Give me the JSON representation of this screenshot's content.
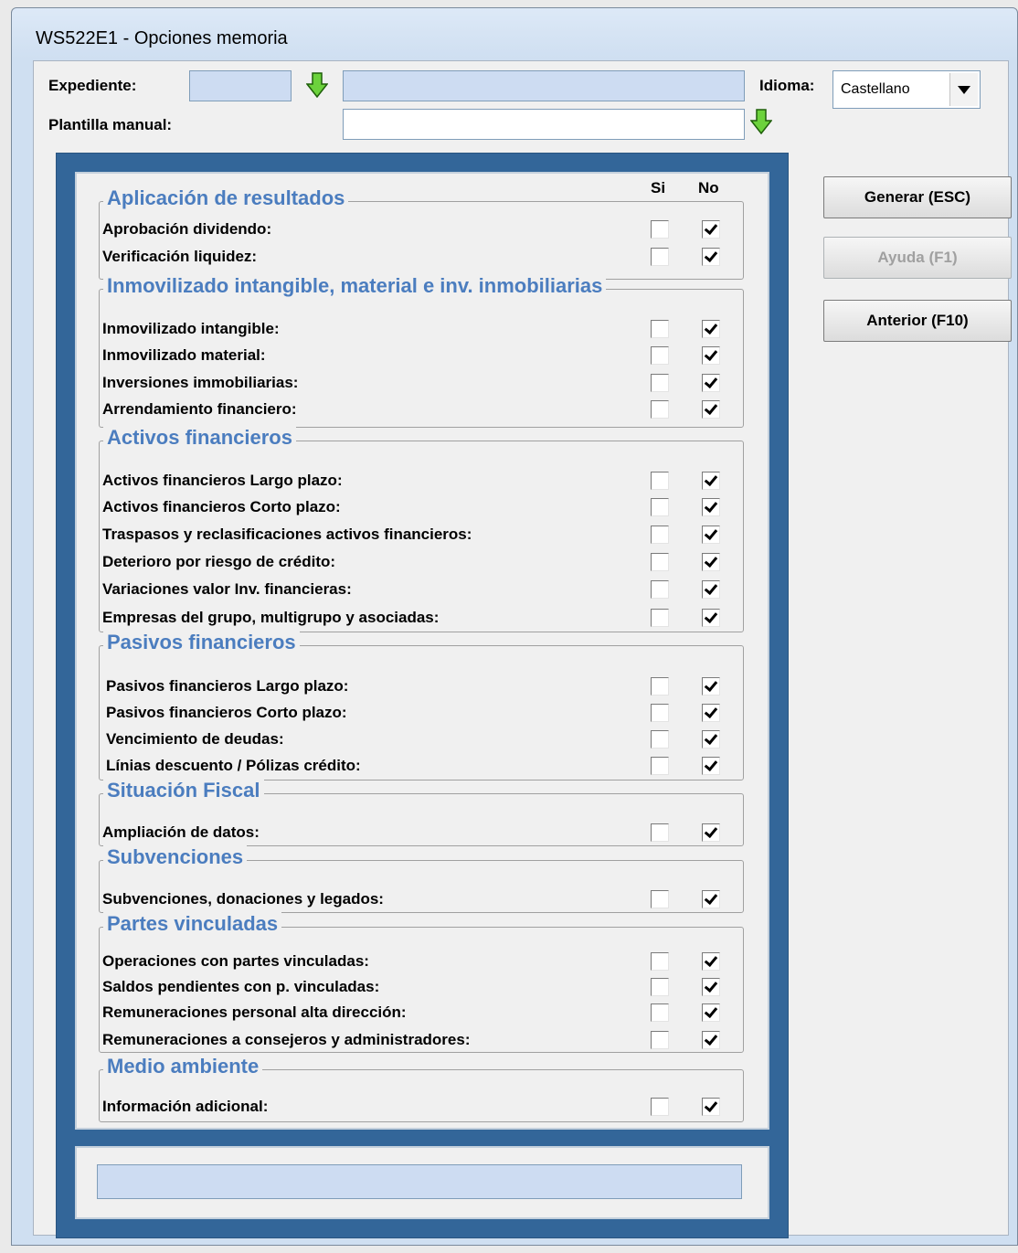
{
  "window": {
    "title": "WS522E1 - Opciones memoria"
  },
  "header": {
    "expediente_label": "Expediente:",
    "expediente_code": "",
    "expediente_name": "",
    "plantilla_label": "Plantilla manual:",
    "plantilla_value": "",
    "idioma_label": "Idioma:",
    "idioma_value": "Castellano"
  },
  "columns": {
    "si": "Si",
    "no": "No"
  },
  "groups": [
    {
      "title": "Aplicación de resultados",
      "items": [
        {
          "label": "Aprobación dividendo:",
          "si": false,
          "no": true
        },
        {
          "label": "Verificación liquidez:",
          "si": false,
          "no": true
        }
      ]
    },
    {
      "title": "Inmovilizado intangible, material e inv. inmobiliarias",
      "items": [
        {
          "label": "Inmovilizado intangible:",
          "si": false,
          "no": true
        },
        {
          "label": "Inmovilizado material:",
          "si": false,
          "no": true
        },
        {
          "label": "Inversiones immobiliarias:",
          "si": false,
          "no": true
        },
        {
          "label": "Arrendamiento financiero:",
          "si": false,
          "no": true
        }
      ]
    },
    {
      "title": "Activos financieros",
      "items": [
        {
          "label": "Activos financieros Largo plazo:",
          "si": false,
          "no": true
        },
        {
          "label": "Activos financieros Corto plazo:",
          "si": false,
          "no": true
        },
        {
          "label": "Traspasos y reclasificaciones activos financieros:",
          "si": false,
          "no": true
        },
        {
          "label": "Deterioro por riesgo de crédito:",
          "si": false,
          "no": true
        },
        {
          "label": "Variaciones valor Inv. financieras:",
          "si": false,
          "no": true
        },
        {
          "label": "Empresas del grupo, multigrupo y asociadas:",
          "si": false,
          "no": true
        }
      ]
    },
    {
      "title": "Pasivos financieros",
      "items": [
        {
          "label": "Pasivos financieros Largo plazo:",
          "si": false,
          "no": true
        },
        {
          "label": "Pasivos financieros Corto plazo:",
          "si": false,
          "no": true
        },
        {
          "label": "Vencimiento de deudas:",
          "si": false,
          "no": true
        },
        {
          "label": "Línias descuento / Pólizas crédito:",
          "si": false,
          "no": true
        }
      ]
    },
    {
      "title": "Situación Fiscal",
      "items": [
        {
          "label": "Ampliación de datos:",
          "si": false,
          "no": true
        }
      ]
    },
    {
      "title": "Subvenciones",
      "items": [
        {
          "label": "Subvenciones, donaciones y legados:",
          "si": false,
          "no": true
        }
      ]
    },
    {
      "title": "Partes vinculadas",
      "items": [
        {
          "label": "Operaciones con partes vinculadas:",
          "si": false,
          "no": true
        },
        {
          "label": "Saldos pendientes con p. vinculadas:",
          "si": false,
          "no": true
        },
        {
          "label": "Remuneraciones personal alta dirección:",
          "si": false,
          "no": true
        },
        {
          "label": "Remuneraciones a consejeros y administradores:",
          "si": false,
          "no": true
        }
      ]
    },
    {
      "title": "Medio ambiente",
      "items": [
        {
          "label": "Información adicional:",
          "si": false,
          "no": true
        }
      ]
    }
  ],
  "buttons": {
    "generar": "Generar (ESC)",
    "ayuda": "Ayuda (F1)",
    "anterior": "Anterior (F10)"
  },
  "status_bar": {
    "text": ""
  },
  "colors": {
    "frame": "#336699",
    "group_title": "#4b7dbf",
    "field_blue": "#cddcf2"
  }
}
